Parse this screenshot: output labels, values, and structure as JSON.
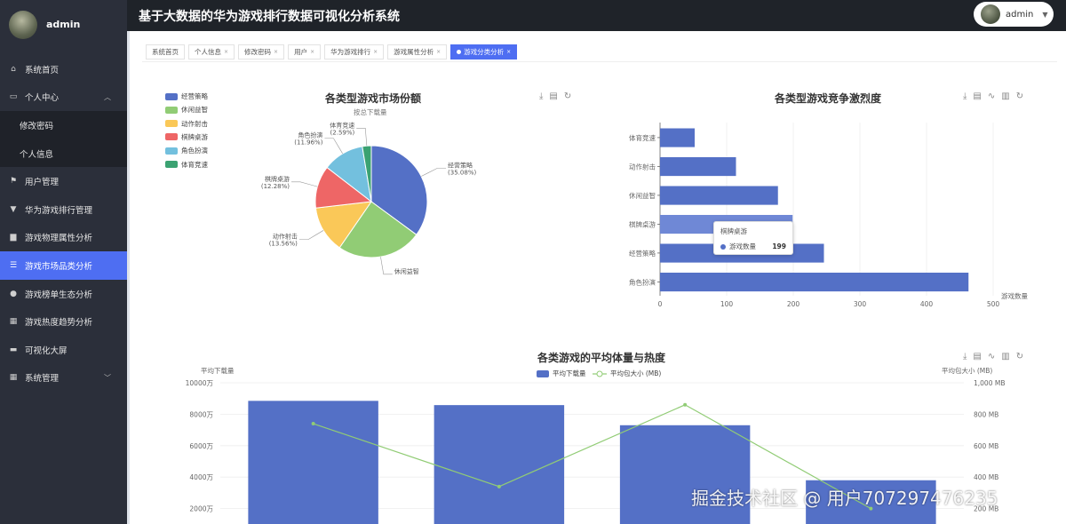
{
  "app_title": "基于大数据的华为游戏排行数据可视化分析系统",
  "user_chip": {
    "name": "admin"
  },
  "sidebar": {
    "username": "admin",
    "items": [
      {
        "label": "系统首页",
        "icon": "home-icon"
      },
      {
        "label": "个人中心",
        "icon": "user-center-icon",
        "expanded": true
      },
      {
        "label": "修改密码",
        "sub": true
      },
      {
        "label": "个人信息",
        "sub": true
      },
      {
        "label": "用户管理",
        "icon": "flag-icon"
      },
      {
        "label": "华为游戏排行管理",
        "icon": "cup-icon"
      },
      {
        "label": "游戏物理属性分析",
        "icon": "chart-icon"
      },
      {
        "label": "游戏市场品类分析",
        "icon": "list-icon",
        "active": true
      },
      {
        "label": "游戏榜单生态分析",
        "icon": "person-icon"
      },
      {
        "label": "游戏热度趋势分析",
        "icon": "grid-icon"
      },
      {
        "label": "可视化大屏",
        "icon": "monitor-icon"
      },
      {
        "label": "系统管理",
        "icon": "grid-icon",
        "collapsible": true
      }
    ]
  },
  "tabs": [
    {
      "label": "系统首页"
    },
    {
      "label": "个人信息"
    },
    {
      "label": "修改密码"
    },
    {
      "label": "用户"
    },
    {
      "label": "华为游戏排行"
    },
    {
      "label": "游戏属性分析"
    },
    {
      "label": "游戏分类分析",
      "active": true
    }
  ],
  "colors": {
    "accent": "#4e6ef2",
    "sidebar_bg": "#2b2f3a",
    "topbar_bg": "#1f2329"
  },
  "chart_data": [
    {
      "type": "pie",
      "title": "各类型游戏市场份额",
      "subtitle": "按总下载量",
      "legend": [
        "经营策略",
        "休闲益智",
        "动作射击",
        "棋牌桌游",
        "角色扮演",
        "体育竞速"
      ],
      "slices": [
        {
          "name": "经营策略",
          "value": 35.08,
          "label": "(35.08%)",
          "color": "#5470c6"
        },
        {
          "name": "休闲益智",
          "value": 24.53,
          "label": "(24.53%)",
          "color": "#91cc75"
        },
        {
          "name": "动作射击",
          "value": 13.56,
          "label": "(13.56%)",
          "color": "#fac858"
        },
        {
          "name": "棋牌桌游",
          "value": 12.28,
          "label": "(12.28%)",
          "color": "#ee6666"
        },
        {
          "name": "角色扮演",
          "value": 11.96,
          "label": "(11.96%)",
          "color": "#73c0de"
        },
        {
          "name": "体育竞速",
          "value": 2.59,
          "label": "(2.59%)",
          "color": "#3ba272"
        }
      ]
    },
    {
      "type": "bar",
      "orientation": "horizontal",
      "title": "各类型游戏竞争激烈度",
      "categories": [
        "体育竞速",
        "动作射击",
        "休闲益智",
        "棋牌桌游",
        "经营策略",
        "角色扮演"
      ],
      "values": [
        52,
        114,
        177,
        199,
        246,
        463
      ],
      "xlabel": "游戏数量",
      "xlim": [
        0,
        500
      ],
      "xticks": [
        "0",
        "100",
        "200",
        "300",
        "400",
        "500"
      ],
      "tooltip": {
        "title": "棋牌桌游",
        "series": "游戏数量",
        "value": "199"
      }
    },
    {
      "type": "bar+line",
      "title": "各类游戏的平均体量与热度",
      "legend": [
        "平均下载量",
        "平均包大小 (MB)"
      ],
      "y_left_label": "平均下载量",
      "y_right_label": "平均包大小 (MB)",
      "y_left_ticks": [
        "10000万",
        "8000万",
        "6000万",
        "4000万",
        "2000万"
      ],
      "y_right_ticks": [
        "1,000 MB",
        "800 MB",
        "600 MB",
        "400 MB",
        "200 MB"
      ],
      "ylim_left": [
        0,
        10000
      ],
      "ylim_right": [
        0,
        1000
      ],
      "series": [
        {
          "name": "平均下载量",
          "type": "bar",
          "values": [
            8850,
            8580,
            7300,
            3800
          ]
        },
        {
          "name": "平均包大小 (MB)",
          "type": "line",
          "values": [
            740,
            340,
            860,
            200
          ]
        }
      ]
    }
  ],
  "watermark": "掘金技术社区 @ 用户707297476235"
}
